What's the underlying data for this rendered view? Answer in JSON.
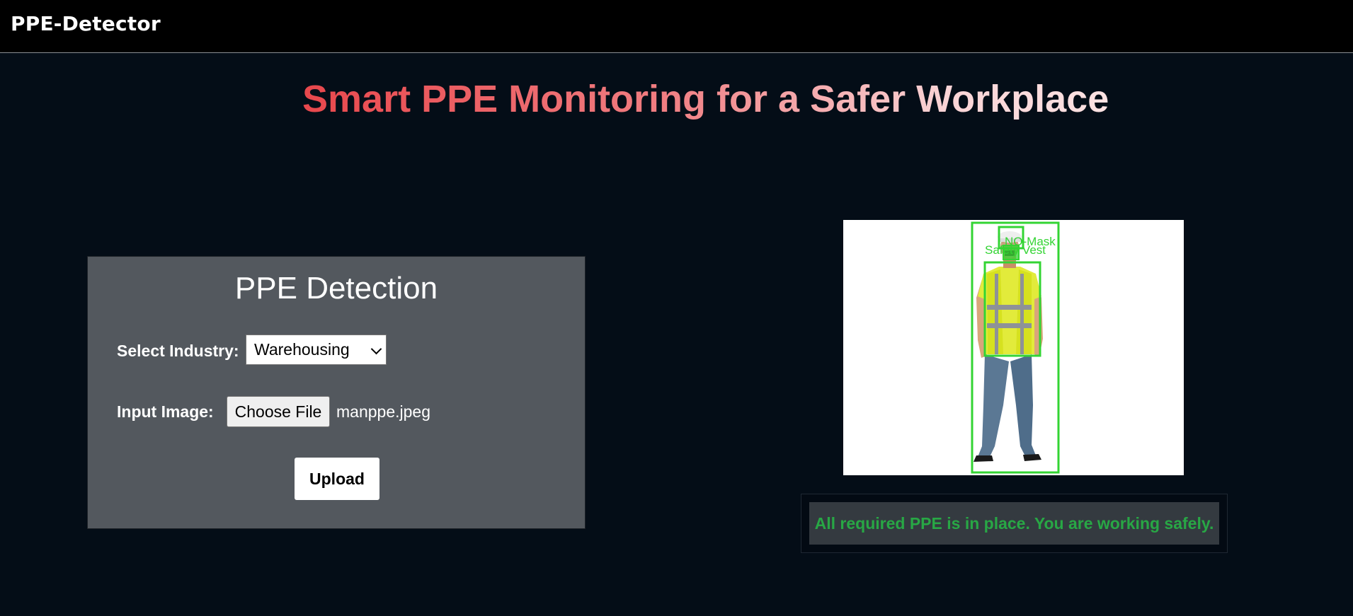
{
  "navbar": {
    "brand": "PPE-Detector"
  },
  "hero": {
    "title": "Smart PPE Monitoring for a Safer Workplace"
  },
  "form": {
    "heading": "PPE Detection",
    "industry_label": "Select Industry:",
    "industry_selected": "Warehousing",
    "image_label": "Input Image:",
    "choose_file_label": "Choose File",
    "file_name": "manppe.jpeg",
    "upload_label": "Upload"
  },
  "result": {
    "detections": [
      {
        "label": "NO-Mask"
      },
      {
        "label": "Safety Vest"
      }
    ],
    "status_message": "All required PPE is in place. You are working safely."
  },
  "colors": {
    "background": "#040d17",
    "navbar": "#000000",
    "panel": "#53585e",
    "status_text": "#28a745",
    "detection_box": "#33d433",
    "title_gradient_start": "#e8474c",
    "title_gradient_end": "#fde2e3"
  },
  "icons": {
    "select_toggle": "chevron-down-icon"
  }
}
